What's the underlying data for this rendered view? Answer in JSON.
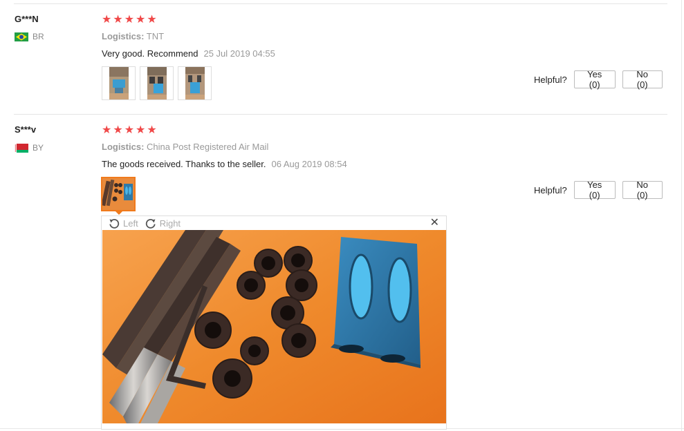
{
  "reviews": [
    {
      "user": "G***N",
      "country": "BR",
      "rating": 5,
      "logistics_label": "Logistics:",
      "logistics_value": "TNT",
      "text": "Very good. Recommend",
      "date": "25 Jul 2019 04:55",
      "photo_count": 3,
      "helpful_label": "Helpful?",
      "yes_label": "Yes (0)",
      "no_label": "No (0)"
    },
    {
      "user": "S***v",
      "country": "BY",
      "rating": 5,
      "logistics_label": "Logistics:",
      "logistics_value": "China Post Registered Air Mail",
      "text": "The goods received. Thanks to the seller.",
      "date": "06 Aug 2019 08:54",
      "photo_count": 1,
      "helpful_label": "Helpful?",
      "yes_label": "Yes (0)",
      "no_label": "No (0)"
    }
  ],
  "viewer": {
    "rotate_left_label": "Left",
    "rotate_right_label": "Right",
    "close_icon": "close-icon"
  },
  "colors": {
    "star": "#f04848",
    "active_thumb_border": "#f07a1c",
    "muted_text": "#999999"
  }
}
